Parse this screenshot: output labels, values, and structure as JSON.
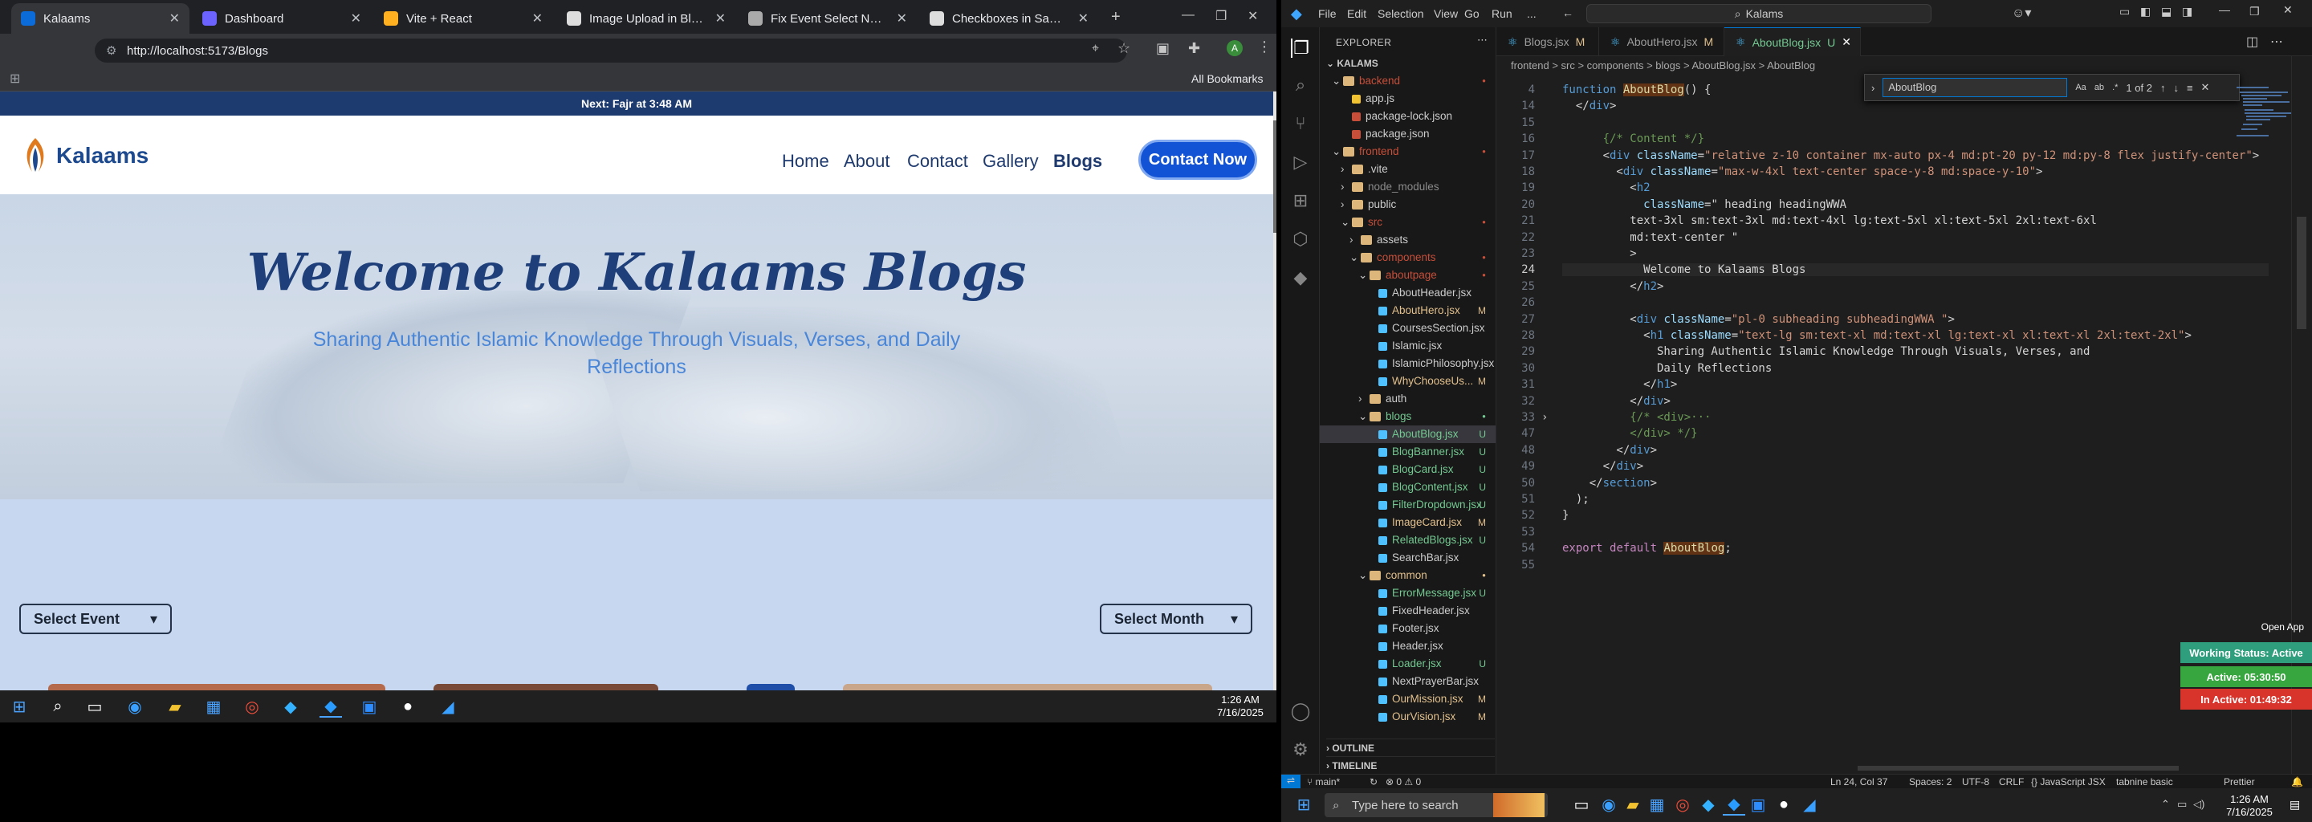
{
  "browser": {
    "tabs": [
      {
        "title": "Kalaams",
        "color": "#0b6bd8"
      },
      {
        "title": "Dashboard",
        "color": "#6c63ff"
      },
      {
        "title": "Vite + React",
        "color": "#ffb020"
      },
      {
        "title": "Image Upload in Blog Editor",
        "color": "#dddddd"
      },
      {
        "title": "Fix Event Select Not Working",
        "color": "#aaaaaa"
      },
      {
        "title": "Checkboxes in Same Row",
        "color": "#dddddd"
      }
    ],
    "url": "http://localhost:5173/Blogs",
    "bookmarks_label": "All Bookmarks",
    "site": {
      "prayer_bar": "Next: Fajr at 3:48 AM",
      "logo_text": "Kalaams",
      "nav": [
        "Home",
        "About",
        "Contact",
        "Gallery",
        "Blogs"
      ],
      "contact_button": "Contact Now",
      "hero_title": "Welcome to Kalaams Blogs",
      "hero_subtitle": "Sharing Authentic Islamic Knowledge Through Visuals, Verses, and Daily Reflections",
      "select_event": "Select Event",
      "select_month": "Select Month"
    },
    "taskbar_time": "1:26 AM",
    "taskbar_date": "7/16/2025"
  },
  "vscode": {
    "menu": [
      "File",
      "Edit",
      "Selection",
      "View",
      "Go",
      "Run",
      "..."
    ],
    "command_center": "Kalams",
    "explorer_title": "EXPLORER",
    "workspace": "KALAMS",
    "tree": [
      {
        "label": "backend",
        "type": "folder-open",
        "depth": 1,
        "status": "dot",
        "cls": "del"
      },
      {
        "label": "app.js",
        "type": "file",
        "depth": 2,
        "icon": "#f1c232"
      },
      {
        "label": "package-lock.json",
        "type": "file",
        "depth": 2,
        "icon": "#c74e39"
      },
      {
        "label": "package.json",
        "type": "file",
        "depth": 2,
        "icon": "#c74e39"
      },
      {
        "label": "frontend",
        "type": "folder-open",
        "depth": 1,
        "status": "dot",
        "cls": "del"
      },
      {
        "label": ".vite",
        "type": "folder",
        "depth": 2
      },
      {
        "label": "node_modules",
        "type": "folder",
        "depth": 2,
        "muted": true
      },
      {
        "label": "public",
        "type": "folder",
        "depth": 2
      },
      {
        "label": "src",
        "type": "folder-open",
        "depth": 2,
        "status": "dot",
        "cls": "del"
      },
      {
        "label": "assets",
        "type": "folder",
        "depth": 3
      },
      {
        "label": "components",
        "type": "folder-open",
        "depth": 3,
        "status": "dot",
        "cls": "del"
      },
      {
        "label": "aboutpage",
        "type": "folder-open",
        "depth": 4,
        "status": "dot",
        "cls": "del"
      },
      {
        "label": "AboutHeader.jsx",
        "type": "file",
        "depth": 5,
        "icon": "#4fc1ff"
      },
      {
        "label": "AboutHero.jsx",
        "type": "file",
        "depth": 5,
        "icon": "#4fc1ff",
        "status": "M",
        "cls": "mod"
      },
      {
        "label": "CoursesSection.jsx",
        "type": "file",
        "depth": 5,
        "icon": "#4fc1ff"
      },
      {
        "label": "Islamic.jsx",
        "type": "file",
        "depth": 5,
        "icon": "#4fc1ff"
      },
      {
        "label": "IslamicPhilosophy.jsx",
        "type": "file",
        "depth": 5,
        "icon": "#4fc1ff"
      },
      {
        "label": "WhyChooseUs...",
        "type": "file",
        "depth": 5,
        "icon": "#4fc1ff",
        "status": "M",
        "cls": "mod"
      },
      {
        "label": "auth",
        "type": "folder",
        "depth": 4
      },
      {
        "label": "blogs",
        "type": "folder-open",
        "depth": 4,
        "status": "dot",
        "cls": "untr"
      },
      {
        "label": "AboutBlog.jsx",
        "type": "file",
        "depth": 5,
        "icon": "#4fc1ff",
        "status": "U",
        "cls": "untr",
        "selected": true
      },
      {
        "label": "BlogBanner.jsx",
        "type": "file",
        "depth": 5,
        "icon": "#4fc1ff",
        "status": "U",
        "cls": "untr"
      },
      {
        "label": "BlogCard.jsx",
        "type": "file",
        "depth": 5,
        "icon": "#4fc1ff",
        "status": "U",
        "cls": "untr"
      },
      {
        "label": "BlogContent.jsx",
        "type": "file",
        "depth": 5,
        "icon": "#4fc1ff",
        "status": "U",
        "cls": "untr"
      },
      {
        "label": "FilterDropdown.jsx",
        "type": "file",
        "depth": 5,
        "icon": "#4fc1ff",
        "status": "U",
        "cls": "untr"
      },
      {
        "label": "ImageCard.jsx",
        "type": "file",
        "depth": 5,
        "icon": "#4fc1ff",
        "status": "M",
        "cls": "mod"
      },
      {
        "label": "RelatedBlogs.jsx",
        "type": "file",
        "depth": 5,
        "icon": "#4fc1ff",
        "status": "U",
        "cls": "untr"
      },
      {
        "label": "SearchBar.jsx",
        "type": "file",
        "depth": 5,
        "icon": "#4fc1ff"
      },
      {
        "label": "common",
        "type": "folder-open",
        "depth": 4,
        "status": "dot",
        "cls": "mod"
      },
      {
        "label": "ErrorMessage.jsx",
        "type": "file",
        "depth": 5,
        "icon": "#4fc1ff",
        "status": "U",
        "cls": "untr"
      },
      {
        "label": "FixedHeader.jsx",
        "type": "file",
        "depth": 5,
        "icon": "#4fc1ff"
      },
      {
        "label": "Footer.jsx",
        "type": "file",
        "depth": 5,
        "icon": "#4fc1ff"
      },
      {
        "label": "Header.jsx",
        "type": "file",
        "depth": 5,
        "icon": "#4fc1ff"
      },
      {
        "label": "Loader.jsx",
        "type": "file",
        "depth": 5,
        "icon": "#4fc1ff",
        "status": "U",
        "cls": "untr"
      },
      {
        "label": "NextPrayerBar.jsx",
        "type": "file",
        "depth": 5,
        "icon": "#4fc1ff"
      },
      {
        "label": "OurMission.jsx",
        "type": "file",
        "depth": 5,
        "icon": "#4fc1ff",
        "status": "M",
        "cls": "mod"
      },
      {
        "label": "OurVision.jsx",
        "type": "file",
        "depth": 5,
        "icon": "#4fc1ff",
        "status": "M",
        "cls": "mod"
      }
    ],
    "outline": "OUTLINE",
    "timeline": "TIMELINE",
    "editor_tabs": [
      {
        "label": "Blogs.jsx",
        "status": "M"
      },
      {
        "label": "AboutHero.jsx",
        "status": "M"
      },
      {
        "label": "AboutBlog.jsx",
        "status": "U",
        "active": true
      }
    ],
    "breadcrumb": "frontend > src > components > blogs > AboutBlog.jsx > AboutBlog",
    "find": {
      "value": "AboutBlog",
      "count": "1 of 2"
    },
    "code_lines": [
      {
        "n": "4",
        "t": "function AboutBlog() {"
      },
      {
        "n": "14",
        "t": "  </div>"
      },
      {
        "n": "15",
        "t": ""
      },
      {
        "n": "16",
        "t": "      {/* Content */}"
      },
      {
        "n": "17",
        "t": "      <div className=\"relative z-10 container mx-auto px-4 md:pt-20 py-12 md:py-8 flex justify-center\">"
      },
      {
        "n": "18",
        "t": "        <div className=\"max-w-4xl text-center space-y-8 md:space-y-10\">"
      },
      {
        "n": "19",
        "t": "          <h2"
      },
      {
        "n": "20",
        "t": "            className=\" heading headingWWA"
      },
      {
        "n": "21",
        "t": "          text-3xl sm:text-3xl md:text-4xl lg:text-5xl xl:text-5xl 2xl:text-6xl"
      },
      {
        "n": "22",
        "t": "          md:text-center \""
      },
      {
        "n": "23",
        "t": "          >"
      },
      {
        "n": "24",
        "t": "            Welcome to Kalaams Blogs"
      },
      {
        "n": "25",
        "t": "          </h2>"
      },
      {
        "n": "26",
        "t": ""
      },
      {
        "n": "27",
        "t": "          <div className=\"pl-0 subheading subheadingWWA \">"
      },
      {
        "n": "28",
        "t": "            <h1 className=\"text-lg sm:text-xl md:text-xl lg:text-xl xl:text-xl 2xl:text-2xl\">"
      },
      {
        "n": "29",
        "t": "              Sharing Authentic Islamic Knowledge Through Visuals, Verses, and"
      },
      {
        "n": "30",
        "t": "              Daily Reflections"
      },
      {
        "n": "31",
        "t": "            </h1>"
      },
      {
        "n": "32",
        "t": "          </div>"
      },
      {
        "n": "33",
        "t": "          {/* <div>···"
      },
      {
        "n": "47",
        "t": "          </div> */}"
      },
      {
        "n": "48",
        "t": "        </div>"
      },
      {
        "n": "49",
        "t": "      </div>"
      },
      {
        "n": "50",
        "t": "    </section>"
      },
      {
        "n": "51",
        "t": "  );"
      },
      {
        "n": "52",
        "t": "}"
      },
      {
        "n": "53",
        "t": ""
      },
      {
        "n": "54",
        "t": "export default AboutBlog;"
      },
      {
        "n": "55",
        "t": ""
      }
    ],
    "status": {
      "branch": "main*",
      "errors": "0 ⚠ 0",
      "position": "Ln 24, Col 37",
      "spaces": "Spaces: 2",
      "encoding": "UTF-8",
      "eol": "CRLF",
      "language": "{} JavaScript JSX",
      "tabnine": "tabnine basic",
      "prettier": "Prettier"
    },
    "open_app": "Open App",
    "working_status": "Working Status: Active",
    "active_time": "Active: 05:30:50",
    "inactive_time": "In Active: 01:49:32",
    "colors": {
      "working": "#2e9e7c",
      "active": "#37a63e",
      "inactive": "#d9342b"
    }
  },
  "taskbar_right": {
    "search_placeholder": "Type here to search",
    "time": "1:26 AM",
    "date": "7/16/2025"
  }
}
